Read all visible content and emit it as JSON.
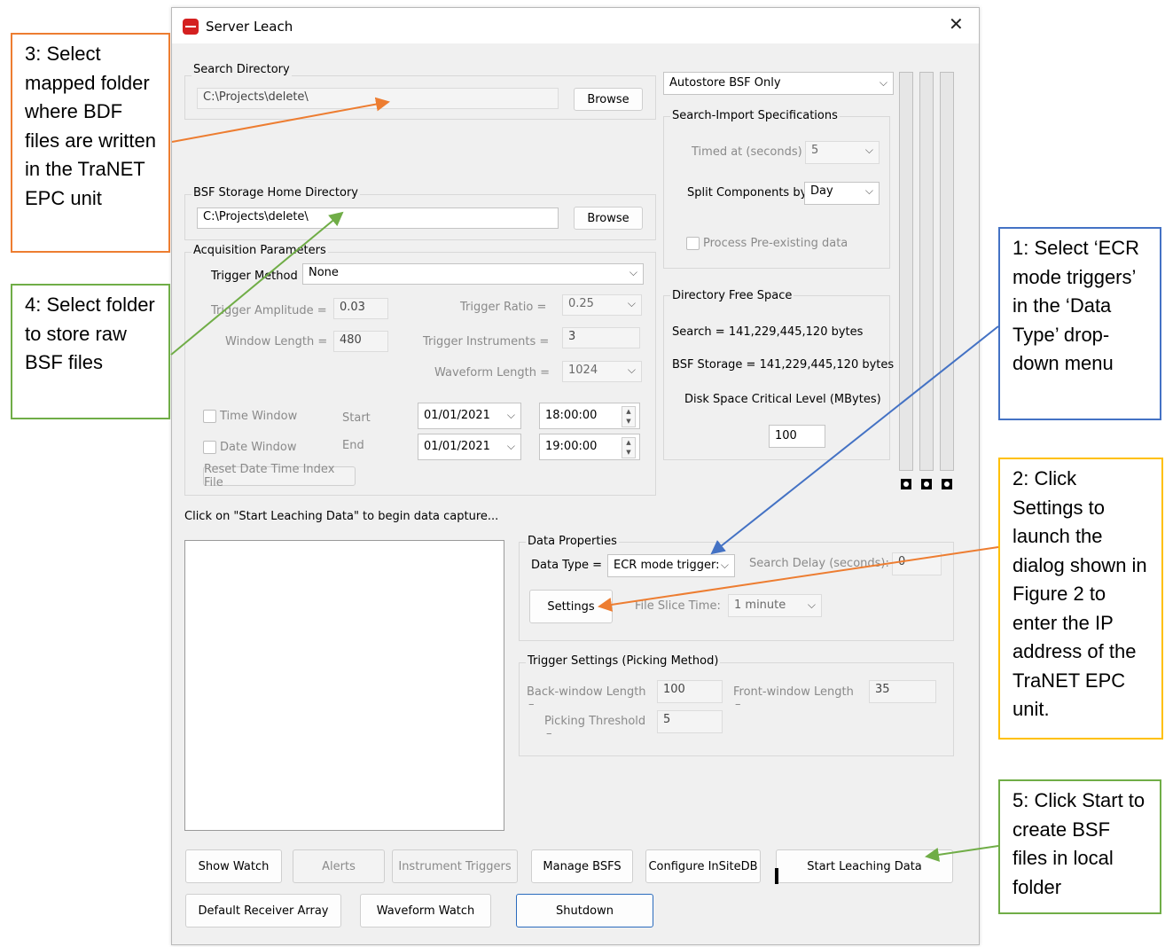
{
  "window": {
    "title": "Server Leach"
  },
  "search_directory": {
    "label": "Search Directory",
    "path": "C:\\Projects\\delete\\",
    "browse_label": "Browse"
  },
  "bsf_storage": {
    "label": "BSF Storage Home Directory",
    "path": "C:\\Projects\\delete\\",
    "browse_label": "Browse"
  },
  "acquisition": {
    "label": "Acquisition Parameters",
    "trigger_method_label": "Trigger Method",
    "trigger_method_value": "None",
    "trigger_amplitude_label": "Trigger Amplitude =",
    "trigger_amplitude_value": "0.03",
    "window_length_label": "Window Length =",
    "window_length_value": "480",
    "trigger_ratio_label": "Trigger Ratio =",
    "trigger_ratio_value": "0.25",
    "trigger_instruments_label": "Trigger Instruments =",
    "trigger_instruments_value": "3",
    "waveform_length_label": "Waveform Length =",
    "waveform_length_value": "1024",
    "time_window_label": "Time Window",
    "date_window_label": "Date Window",
    "start_label": "Start",
    "end_label": "End",
    "start_date": "01/01/2021",
    "end_date": "01/01/2021",
    "start_time": "18:00:00",
    "end_time": "19:00:00",
    "reset_label": "Reset Date Time Index File"
  },
  "autostore": {
    "value": "Autostore BSF Only"
  },
  "search_import": {
    "label": "Search-Import Specifications",
    "timed_at_label": "Timed at (seconds)",
    "timed_at_value": "5",
    "split_label": "Split Components by",
    "split_value": "Day",
    "process_label": "Process Pre-existing data"
  },
  "free_space": {
    "label": "Directory Free Space",
    "search_text": "Search = 141,229,445,120 bytes",
    "bsf_text": "BSF Storage = 141,229,445,120 bytes",
    "critical_label": "Disk Space Critical Level (MBytes)",
    "critical_value": "100"
  },
  "status_text": "Click on \"Start Leaching Data\" to begin data capture...",
  "data_properties": {
    "label": "Data Properties",
    "data_type_label": "Data Type =",
    "data_type_value": "ECR mode trigger:",
    "search_delay_label": "Search Delay (seconds):",
    "search_delay_value": "0",
    "settings_label": "Settings",
    "file_slice_label": "File Slice Time:",
    "file_slice_value": "1 minute"
  },
  "trigger_settings": {
    "label": "Trigger Settings (Picking Method)",
    "back_window_label": "Back-window Length",
    "back_window_value": "100",
    "front_window_label": "Front-window Length",
    "front_window_value": "35",
    "picking_threshold_label": "Picking Threshold",
    "picking_threshold_value": "5",
    "dash": "–"
  },
  "buttons": {
    "show_watch": "Show Watch",
    "alerts": "Alerts",
    "instrument_triggers": "Instrument Triggers",
    "manage_bsfs": "Manage BSFS",
    "configure_insitedb": "Configure InSiteDB",
    "start_leaching": "Start Leaching Data",
    "default_receiver": "Default Receiver Array",
    "waveform_watch": "Waveform Watch",
    "shutdown": "Shutdown"
  },
  "annotations": {
    "note1": "1: Select ‘ECR mode triggers’ in the ‘Data Type’ drop-down menu",
    "note2": "2: Click Settings to launch the dialog shown in Figure 2 to enter the IP address of the TraNET EPC unit.",
    "note3": "3: Select mapped folder where BDF files are written in the TraNET EPC unit",
    "note4": "4: Select folder to store raw BSF files",
    "note5": "5: Click Start to create BSF files in local folder",
    "colors": {
      "blue": "#4472c4",
      "orange": "#ed7d31",
      "green": "#70ad47",
      "yellow": "#ffc000"
    }
  }
}
